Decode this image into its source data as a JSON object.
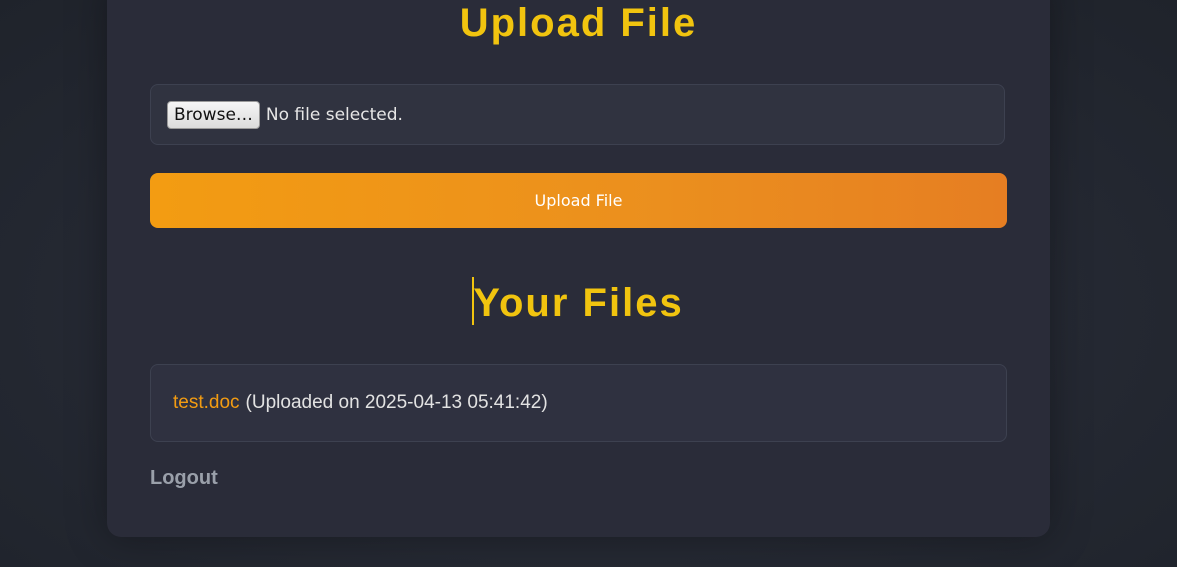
{
  "upload_section": {
    "heading": "Upload File",
    "browse_label": "Browse…",
    "no_file_text": "No file selected.",
    "submit_label": "Upload File"
  },
  "files_section": {
    "heading": "Your Files",
    "files": [
      {
        "name": "test.doc",
        "meta": "(Uploaded on 2025-04-13 05:41:42)"
      }
    ]
  },
  "logout_label": "Logout",
  "colors": {
    "accent": "#f1c40f",
    "button_start": "#f39c12",
    "button_end": "#e67e22",
    "link": "#f39c12"
  }
}
